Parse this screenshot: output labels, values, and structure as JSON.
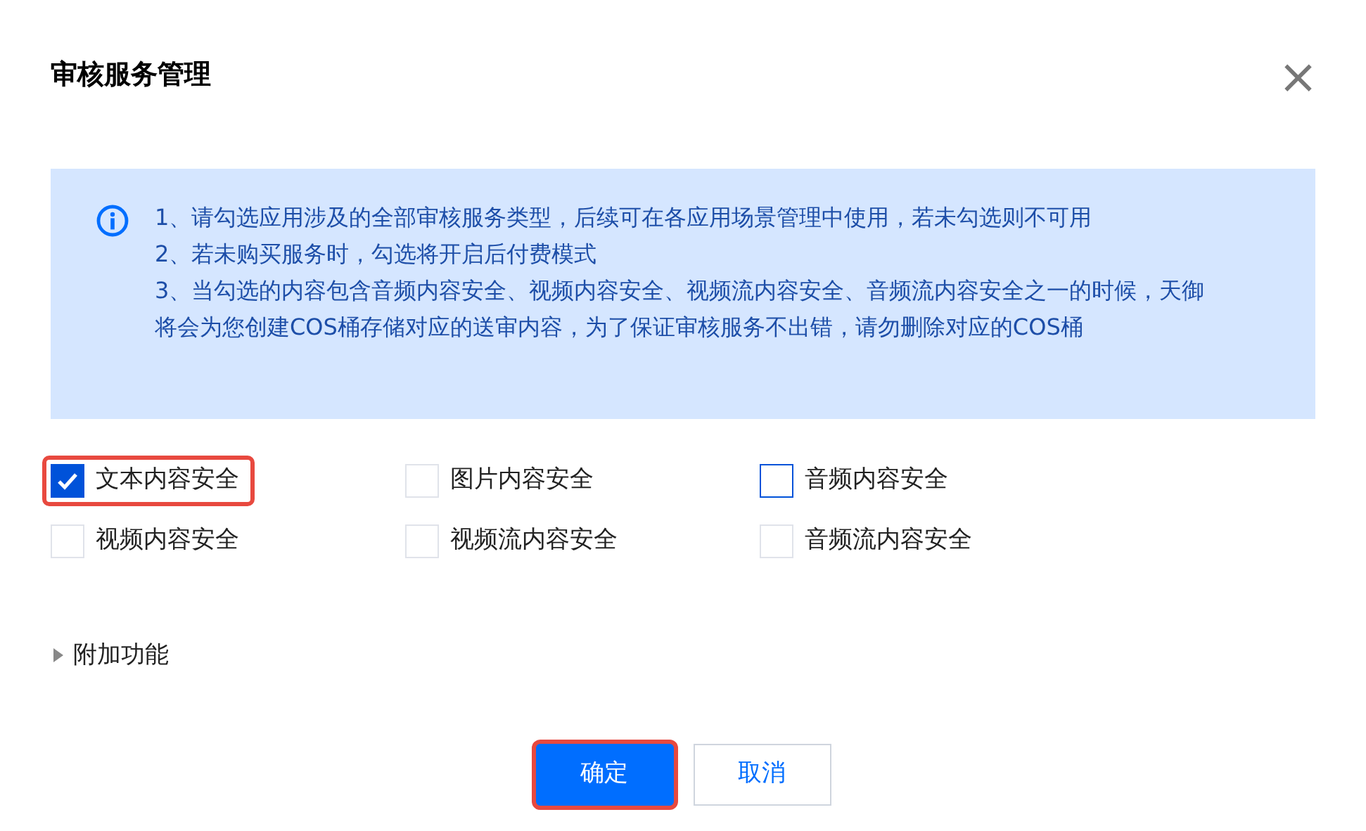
{
  "dialog": {
    "title": "审核服务管理",
    "close": "×"
  },
  "notice": [
    "1、请勾选应用涉及的全部审核服务类型，后续可在各应用场景管理中使用，若未勾选则不可用",
    "2、若未购买服务时，勾选将开启后付费模式",
    "3、当勾选的内容包含音频内容安全、视频内容安全、视频流内容安全、音频流内容安全之一的时候，天御将会为您创建COS桶存储对应的送审内容，为了保证审核服务不出错，请勿删除对应的COS桶"
  ],
  "services": [
    {
      "label": "文本内容安全",
      "checked": true,
      "focused": false,
      "highlighted": true
    },
    {
      "label": "图片内容安全",
      "checked": false,
      "focused": false,
      "highlighted": false
    },
    {
      "label": "音频内容安全",
      "checked": false,
      "focused": true,
      "highlighted": false
    },
    {
      "label": "视频内容安全",
      "checked": false,
      "focused": false,
      "highlighted": false
    },
    {
      "label": "视频流内容安全",
      "checked": false,
      "focused": false,
      "highlighted": false
    },
    {
      "label": "音频流内容安全",
      "checked": false,
      "focused": false,
      "highlighted": false
    }
  ],
  "extra": {
    "label": "附加功能",
    "expanded": false
  },
  "buttons": [
    {
      "label": "确定",
      "kind": "primary",
      "highlighted": true
    },
    {
      "label": "取消",
      "kind": "secondary",
      "highlighted": false
    }
  ]
}
